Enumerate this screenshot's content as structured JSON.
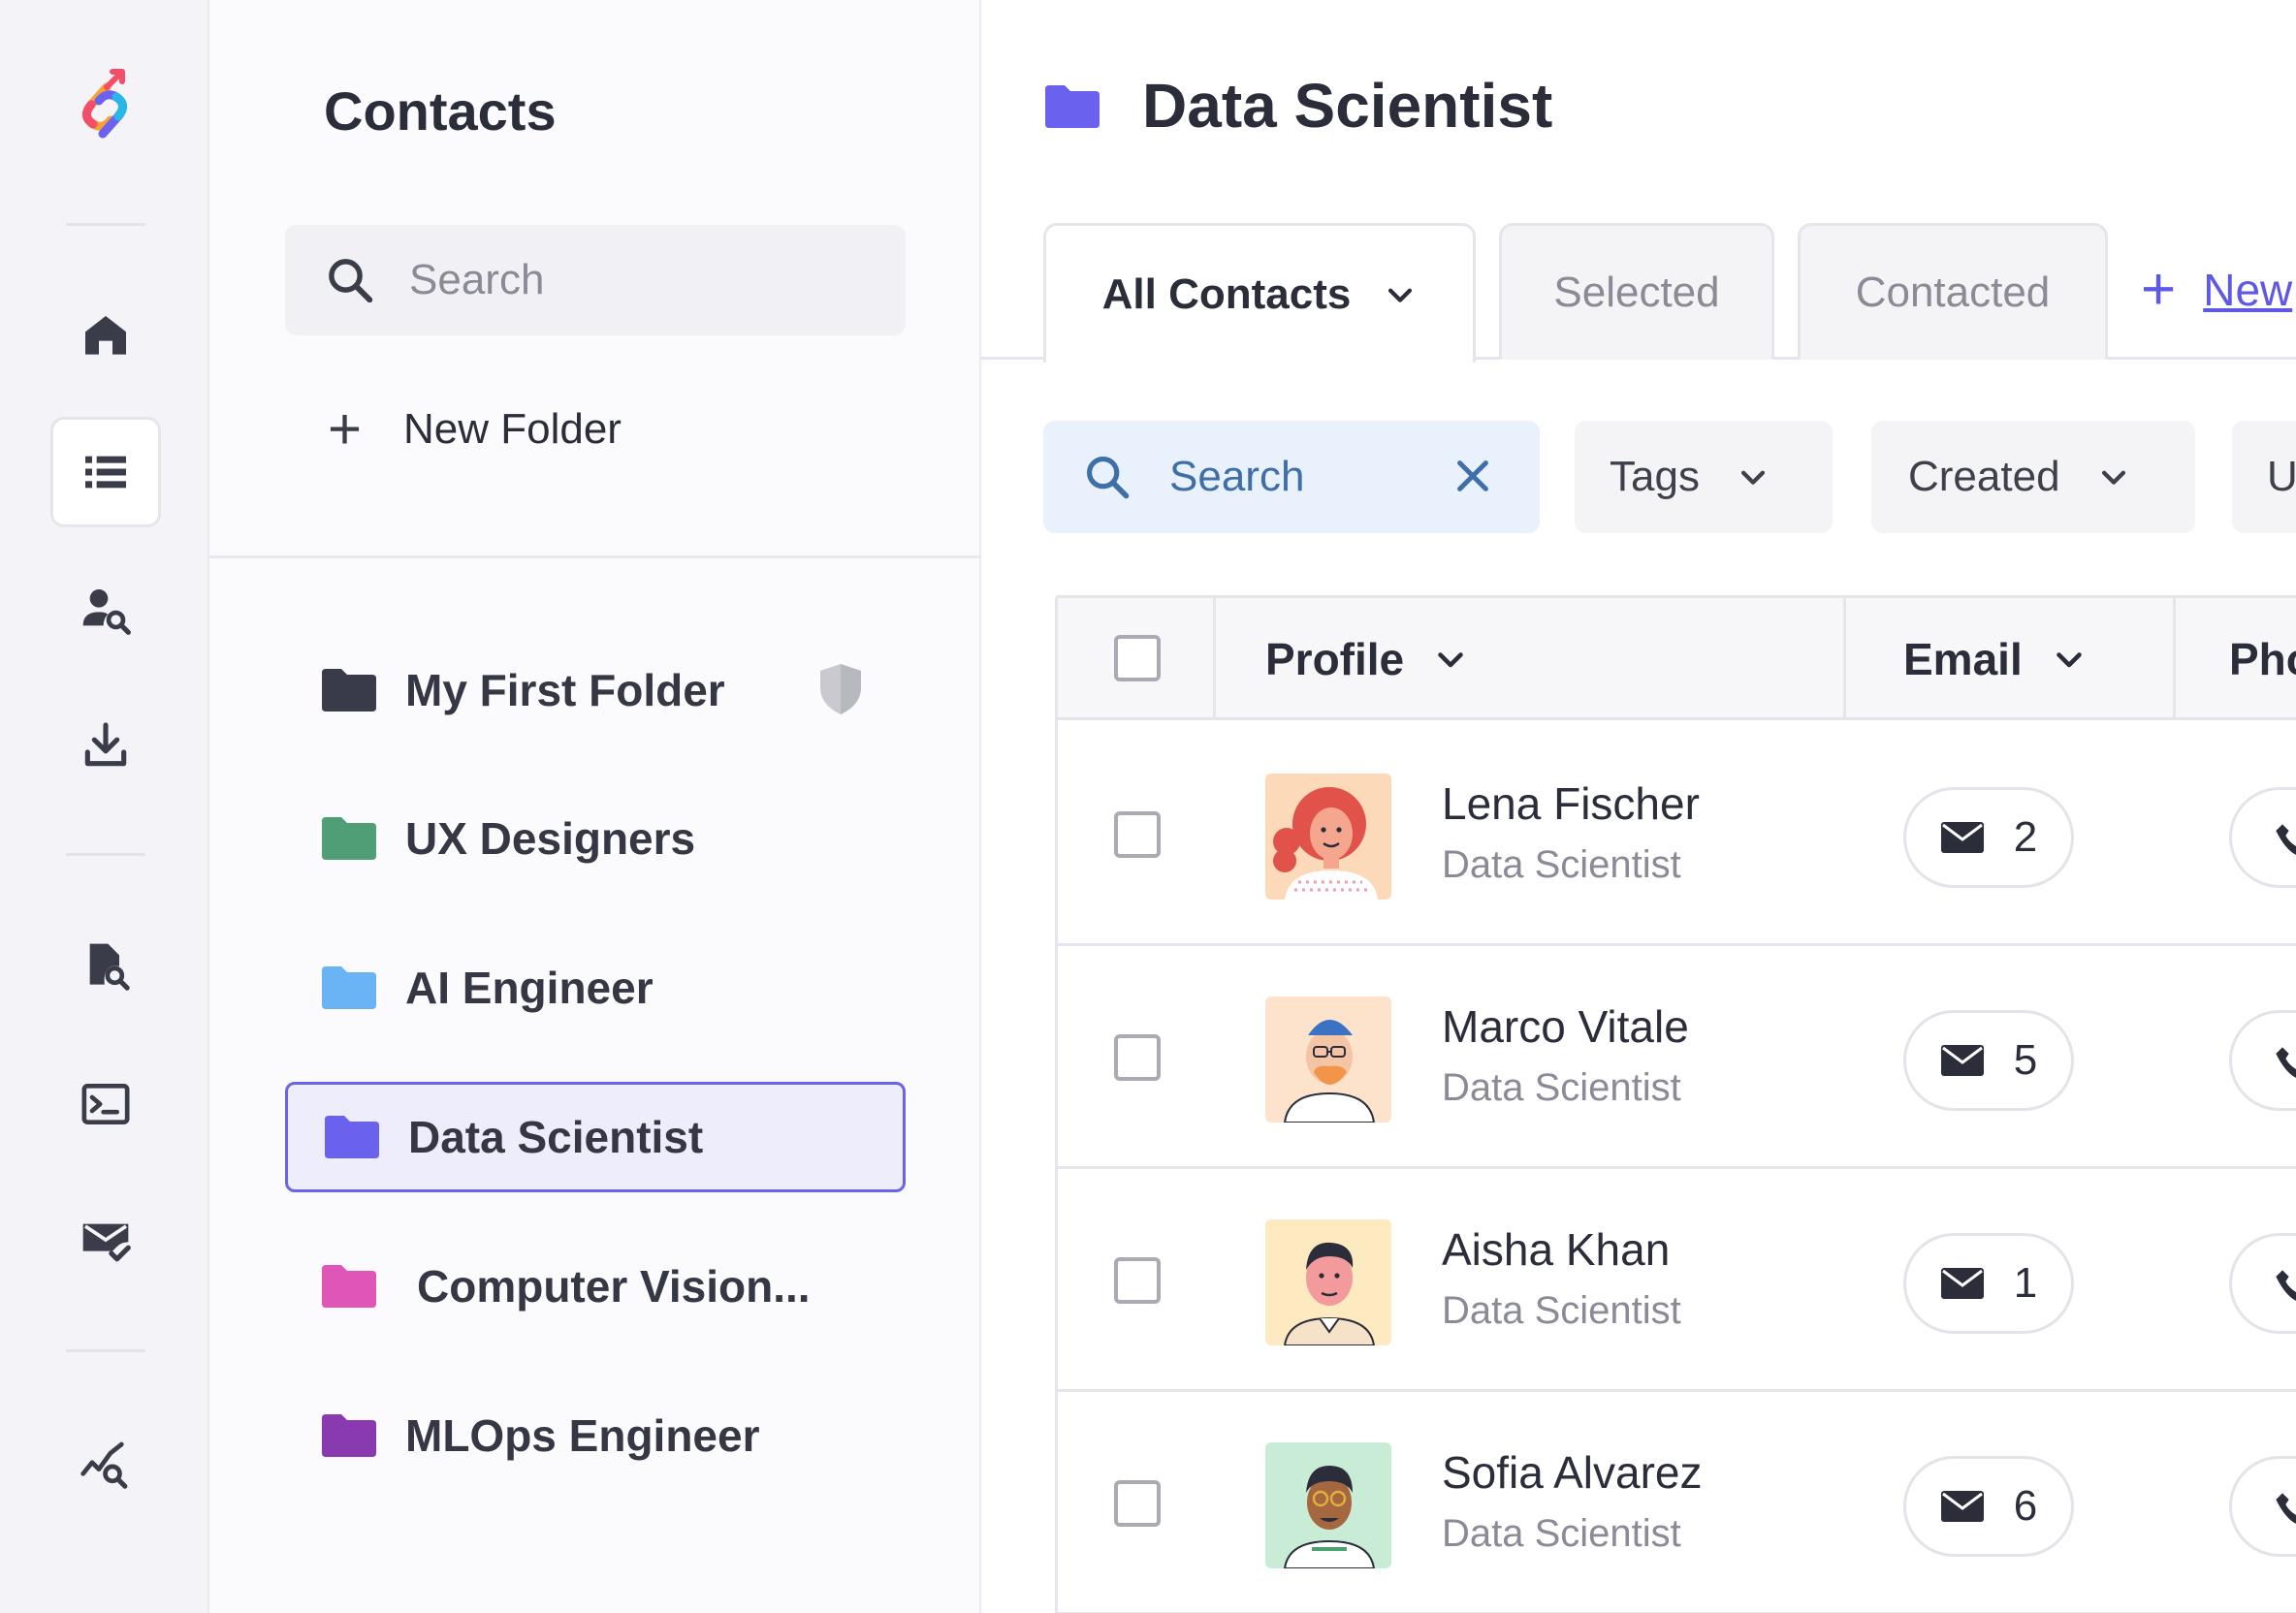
{
  "panel": {
    "title": "Contacts",
    "search_placeholder": "Search",
    "new_folder_label": "New Folder",
    "folders": [
      {
        "label": "My First Folder",
        "color": "#3a3b4a",
        "protected": true
      },
      {
        "label": "UX Designers",
        "color": "#4f9e76"
      },
      {
        "label": "AI Engineer",
        "color": "#6ab4f5"
      },
      {
        "label": "Data Scientist",
        "color": "#6a62ee",
        "selected": true
      },
      {
        "label": "Computer Vision...",
        "color": "#e055b8"
      },
      {
        "label": "MLOps Engineer",
        "color": "#8a3ab0"
      }
    ]
  },
  "main": {
    "title": "Data Scientist",
    "folder_color": "#6a62ee",
    "tabs": [
      {
        "label": "All Contacts",
        "active": true
      },
      {
        "label": "Selected"
      },
      {
        "label": "Contacted"
      }
    ],
    "new_tab_label": "New",
    "filters": {
      "search_label": "Search",
      "tags_label": "Tags",
      "created_label": "Created",
      "next_label": "U"
    },
    "columns": {
      "profile": "Profile",
      "email": "Email",
      "phone": "Pho"
    },
    "rows": [
      {
        "name": "Lena Fischer",
        "role": "Data Scientist",
        "email_count": "2"
      },
      {
        "name": "Marco Vitale",
        "role": "Data Scientist",
        "email_count": "5"
      },
      {
        "name": "Aisha Khan",
        "role": "Data Scientist",
        "email_count": "1"
      },
      {
        "name": "Sofia Alvarez",
        "role": "Data Scientist",
        "email_count": "6"
      }
    ]
  },
  "rail_icons": [
    "app-logo",
    "home-icon",
    "list-icon",
    "user-search-icon",
    "download-icon",
    "document-search-icon",
    "terminal-icon",
    "mail-check-icon",
    "analytics-search-icon"
  ],
  "colors": {
    "accent": "#6b64e6",
    "link": "#5e58e4",
    "search_filter_bg": "#e9f1fc"
  }
}
